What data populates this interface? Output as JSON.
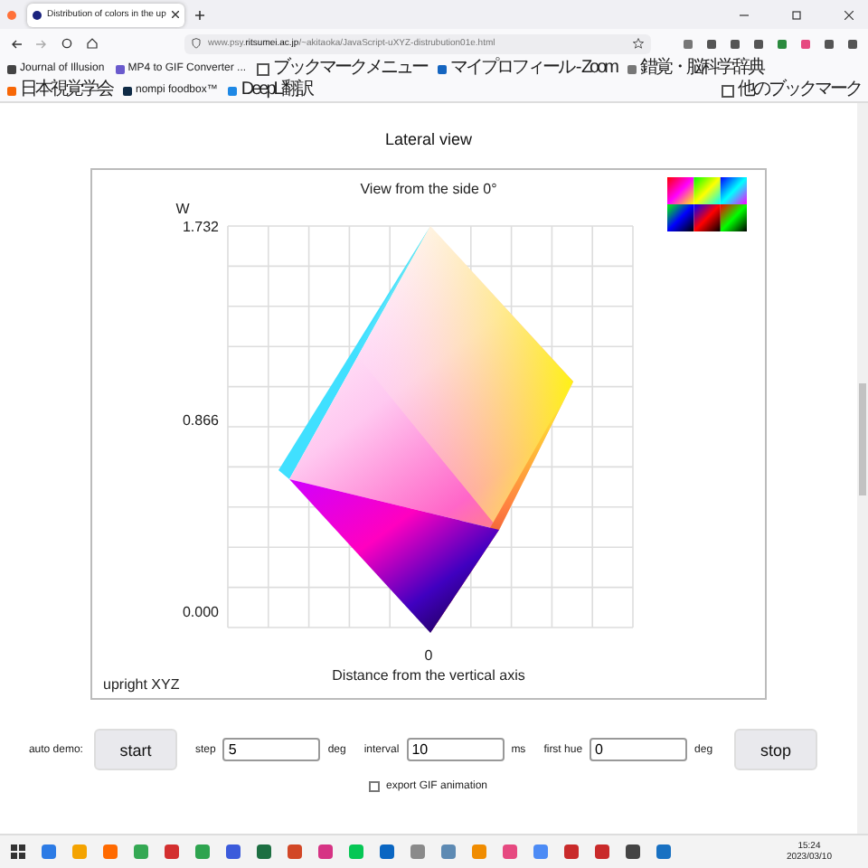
{
  "browser": {
    "tab_title": "Distribution of colors in the up",
    "address": "www.psy.**ritsumei.ac.jp**/~akitaoka/JavaScript-uXYZ-distrubution01e.html",
    "bookmarks": [
      {
        "label": "Journal of Illusion",
        "kind": "site"
      },
      {
        "label": "MP4 to GIF Converter ...",
        "kind": "site"
      },
      {
        "label": "ブックマークメニュー",
        "kind": "folder"
      },
      {
        "label": "マイプロフィール - Zoom",
        "kind": "site"
      },
      {
        "label": "錯覚・脳科学辞典",
        "kind": "site"
      },
      {
        "label": "日本視覚学会",
        "kind": "site"
      },
      {
        "label": "nompi foodbox™",
        "kind": "site"
      },
      {
        "label": "DeepL翻訳",
        "kind": "site"
      }
    ],
    "other_bookmarks": "他のブックマーク"
  },
  "page": {
    "heading": "Lateral view"
  },
  "chart": {
    "title": "View from the side 0°",
    "y_axis_label": "W",
    "y_ticks": [
      "1.732",
      "0.866",
      "0.000"
    ],
    "x_tick": "0",
    "x_axis_label": "Distance from the vertical axis",
    "corner_label": "upright XYZ"
  },
  "controls": {
    "label": "auto demo:",
    "start": "start",
    "stop": "stop",
    "fields": [
      {
        "label": "step",
        "value": "5",
        "unit": "deg"
      },
      {
        "label": "interval",
        "value": "10",
        "unit": "ms"
      },
      {
        "label": "first hue",
        "value": "0",
        "unit": "deg"
      }
    ],
    "export": {
      "label": "export GIF animation",
      "checked": false
    }
  },
  "taskbar": {
    "time": "15:24",
    "date": "2023/03/10"
  }
}
